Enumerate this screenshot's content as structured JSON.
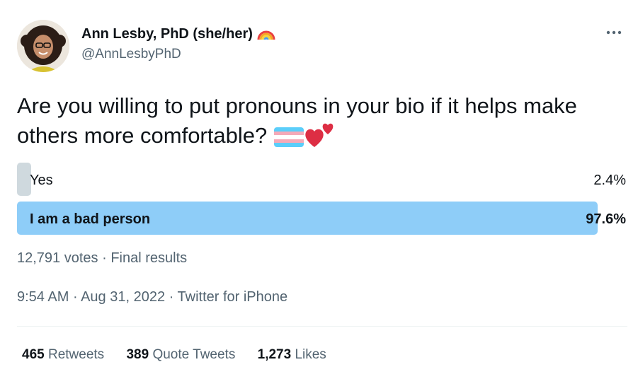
{
  "author": {
    "display_name": "Ann Lesby, PhD (she/her)",
    "handle": "@AnnLesbyPhD",
    "name_emoji": "rainbow-icon",
    "avatar": "avatar-photo"
  },
  "menu": {
    "icon": "more-icon"
  },
  "tweet": {
    "text": "Are you willing to put pronouns in your bio if it helps make others more comfortable?",
    "emojis": [
      "transgender-flag-icon",
      "two-hearts-icon"
    ]
  },
  "poll": {
    "options": [
      {
        "label": "Yes",
        "percent": 2.4,
        "percent_label": "2.4%",
        "winner": false
      },
      {
        "label": "I am a bad person",
        "percent": 97.6,
        "percent_label": "97.6%",
        "winner": true
      }
    ],
    "votes_label": "12,791 votes",
    "separator": "·",
    "status": "Final results"
  },
  "timestamp": {
    "time": "9:54 AM",
    "date": "Aug 31, 2022",
    "source": "Twitter for iPhone"
  },
  "stats": {
    "retweets_count": "465",
    "retweets_label": "Retweets",
    "quotes_count": "389",
    "quotes_label": "Quote Tweets",
    "likes_count": "1,273",
    "likes_label": "Likes"
  },
  "colors": {
    "winner_bar": "#8ecdf8",
    "loser_bar": "#cfd9de",
    "secondary_text": "#536471",
    "primary_text": "#0f1419"
  }
}
